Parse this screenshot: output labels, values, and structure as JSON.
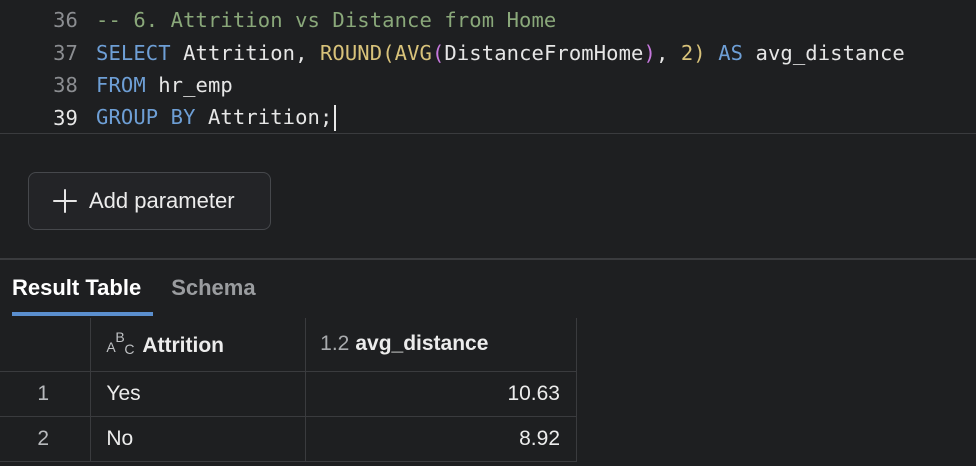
{
  "editor": {
    "lines": [
      {
        "num": "36",
        "comment": "-- 6. Attrition vs Distance from Home"
      },
      {
        "num": "37",
        "select_kw": "SELECT",
        "text1": " Attrition, ",
        "round_fn": "ROUND",
        "paren1": "(",
        "avg_fn": "AVG",
        "paren2_open": "(",
        "arg": "DistanceFromHome",
        "paren2_close": ")",
        "comma": ", ",
        "num_val": "2",
        "paren1_close": ")",
        "as_kw": " AS",
        "alias": " avg_distance"
      },
      {
        "num": "38",
        "from_kw": "FROM",
        "table": " hr_emp"
      },
      {
        "num": "39",
        "group_kw": "GROUP BY",
        "col": " Attrition;"
      }
    ]
  },
  "params": {
    "add_label": "Add parameter"
  },
  "results": {
    "tabs": [
      "Result Table",
      "Schema"
    ],
    "columns": {
      "attrition": "Attrition",
      "avg_type": "1.2",
      "avg_distance": "avg_distance"
    },
    "type_icon_abc": {
      "a": "A",
      "b": "B",
      "c": "C"
    },
    "rows": [
      {
        "idx": "1",
        "attrition": "Yes",
        "avg_distance": "10.63"
      },
      {
        "idx": "2",
        "attrition": "No",
        "avg_distance": "8.92"
      }
    ]
  },
  "colors": {
    "background": "#1e1f21",
    "keyword": "#6e9fd6",
    "function": "#d8c27a",
    "comment": "#8aa87a",
    "tab_accent": "#5b8fcf"
  }
}
